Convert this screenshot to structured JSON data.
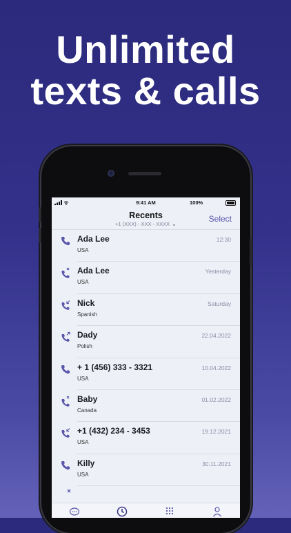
{
  "headline": {
    "line1": "Unlimited",
    "line2": "texts & calls"
  },
  "status_bar": {
    "time": "9:41 AM",
    "battery": "100%"
  },
  "header": {
    "title": "Recents",
    "number": "+1 (XXX) - XXX - XXXX",
    "select": "Select"
  },
  "calls": [
    {
      "name": "Ada Lee",
      "country": "USA",
      "date": "12:30",
      "type": "incoming"
    },
    {
      "name": "Ada Lee",
      "country": "USA",
      "date": "Yesterday",
      "type": "missed"
    },
    {
      "name": "Nick",
      "country": "Spanish",
      "date": "Saturday",
      "type": "incoming-arrow"
    },
    {
      "name": "Dady",
      "country": "Polish",
      "date": "22.04.2022",
      "type": "outgoing"
    },
    {
      "name": "+ 1 (456) 333 - 3321",
      "country": "USA",
      "date": "10.04.2022",
      "type": "incoming"
    },
    {
      "name": "Baby",
      "country": "Canada",
      "date": "01.02.2022",
      "type": "missed"
    },
    {
      "name": "+1 (432) 234 - 3453",
      "country": "USA",
      "date": "19.12.2021",
      "type": "incoming-arrow"
    },
    {
      "name": "Killy",
      "country": "USA",
      "date": "30.11.2021",
      "type": "incoming"
    }
  ],
  "tabs": [
    {
      "icon": "chat-icon"
    },
    {
      "icon": "clock-icon",
      "active": true
    },
    {
      "icon": "keypad-icon"
    },
    {
      "icon": "contact-icon"
    }
  ],
  "colors": {
    "accent": "#5856a8",
    "background": "#2b2a7c"
  }
}
